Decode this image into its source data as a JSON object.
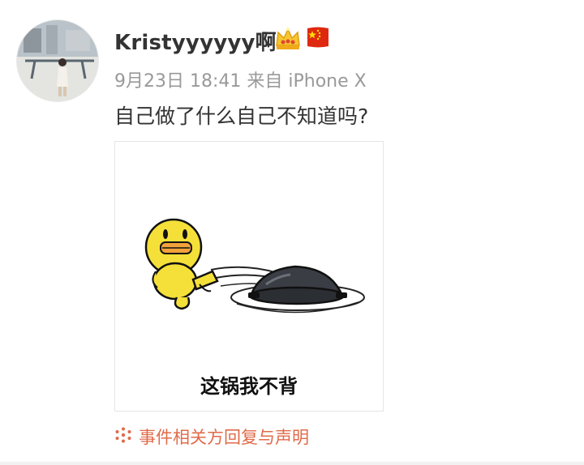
{
  "post": {
    "username": "Kristyyyyyy啊",
    "timestamp": "9月23日 18:41",
    "source": "来自 iPhone X",
    "text": "自己做了什么自己不知道吗?",
    "meme_caption": "这锅我不背",
    "footer_link": "事件相关方回复与声明",
    "badges": [
      "crown-badge-icon",
      "china-flag-icon"
    ],
    "colors": {
      "link": "#e06b4a",
      "meta": "#999999",
      "text": "#333333",
      "duck": "#f5e03a",
      "flag": "#de2910"
    }
  }
}
